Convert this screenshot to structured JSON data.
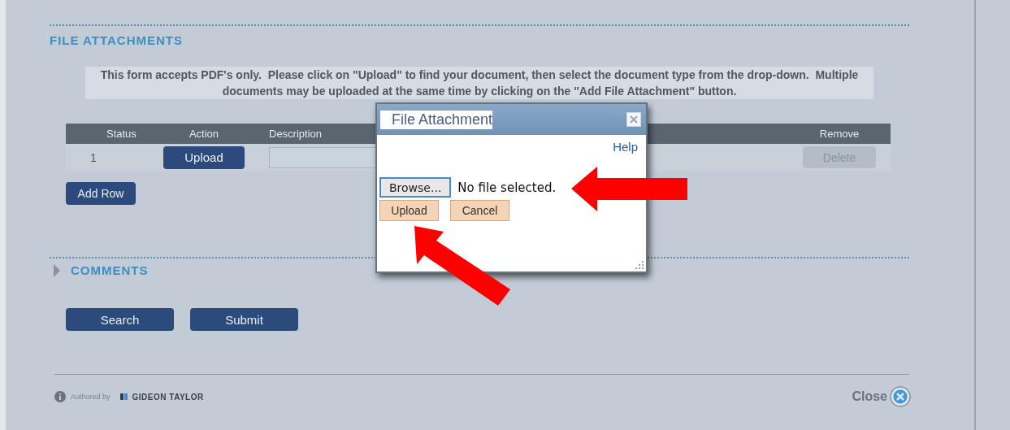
{
  "section": {
    "title": "FILE ATTACHMENTS",
    "instructions": "This form accepts PDF's only.  Please click on \"Upload\" to find your document, then select the document type from the drop-down.  Multiple documents may be uploaded at the same time by clicking on the \"Add File Attachment\" button."
  },
  "table": {
    "columns": [
      "Status",
      "Action",
      "Description",
      "Remove"
    ],
    "rows": [
      {
        "status": "1",
        "action": "Upload",
        "remove": {
          "label": "Delete",
          "disabled": true
        }
      }
    ]
  },
  "add_row": "Add Row",
  "comments": {
    "title": "COMMENTS",
    "expanded": false
  },
  "buttons": [
    "Search",
    "Submit"
  ],
  "footer": {
    "authored_by": "Authored by",
    "brand": "GIDEON TAYLOR",
    "close": "Close"
  },
  "dialog": {
    "title": "File Attachment",
    "help": "Help",
    "browse": "Browse...",
    "file_status": "No file selected.",
    "buttons": [
      "Upload",
      "Cancel"
    ]
  }
}
